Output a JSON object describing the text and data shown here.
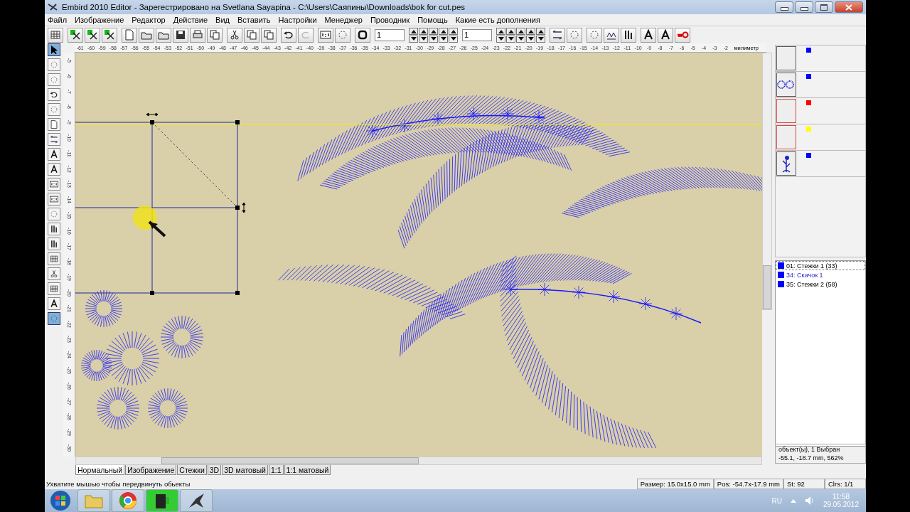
{
  "window": {
    "title": "Embird 2010 Editor - Зарегестрировано на Svetlana Sayapina - C:\\Users\\Саяпины\\Downloads\\bok for cut.pes"
  },
  "menu": [
    "Файл",
    "Изображение",
    "Редактор",
    "Действие",
    "Вид",
    "Вставить",
    "Настройки",
    "Менеджер",
    "Проводник",
    "Помощь",
    "Какие есть дополнения"
  ],
  "toolbar": {
    "fields": [
      {
        "value": "1"
      },
      {
        "value": "1"
      }
    ]
  },
  "tools": [
    {
      "selected": true
    },
    {
      "selected": false
    },
    {
      "selected": false
    },
    {
      "selected": false
    },
    {
      "selected": false
    },
    {
      "selected": false
    },
    {
      "selected": false
    },
    {
      "selected": false
    },
    {
      "selected": false
    },
    {
      "selected": false
    },
    {
      "selected": false
    },
    {
      "selected": false
    },
    {
      "selected": false
    },
    {
      "selected": false
    },
    {
      "selected": false
    },
    {
      "selected": false
    },
    {
      "selected": false
    },
    {
      "selected": false
    },
    {
      "selected": true
    }
  ],
  "ruler": {
    "unit": "милиметр",
    "marks": [
      "-61",
      "-60",
      "-59",
      "-58",
      "-57",
      "-56",
      "-55",
      "-54",
      "-53",
      "-52",
      "-51",
      "-50",
      "-49",
      "-48",
      "-47",
      "-46",
      "-45",
      "-44",
      "-43",
      "-42",
      "-41",
      "-40",
      "-39",
      "-38",
      "-37",
      "-36",
      "-35",
      "-34",
      "-33",
      "-32",
      "-31",
      "-30",
      "-29",
      "-28",
      "-27",
      "-26",
      "-25",
      "-24",
      "-23",
      "-22",
      "-21",
      "-20",
      "-19",
      "-18",
      "-17",
      "-16",
      "-15",
      "-14",
      "-13",
      "-12",
      "-11",
      "-10",
      "-9",
      "-8",
      "-7",
      "-6",
      "-5",
      "-4",
      "-3",
      "-2"
    ],
    "vertical_marks": [
      "-5",
      "-6",
      "-7",
      "-8",
      "-9",
      "-10",
      "-11",
      "-12",
      "-13",
      "-14",
      "-15",
      "-16",
      "-17",
      "-18",
      "-19",
      "-20",
      "-21",
      "-22",
      "-23",
      "-24",
      "-25",
      "-26",
      "-27",
      "-28",
      "-29",
      "-30"
    ]
  },
  "colors": [
    {
      "kind": "empty",
      "color": "#0000ff",
      "selected": false
    },
    {
      "kind": "flowers",
      "color": "#0000ff",
      "selected": false
    },
    {
      "kind": "empty",
      "color": "#ff0000",
      "selected": true
    },
    {
      "kind": "empty",
      "color": "#ffff00",
      "selected": true
    },
    {
      "kind": "sprig",
      "color": "#0000ff",
      "selected": false
    }
  ],
  "objects": [
    {
      "label": "01:  Стежки 1 (33)",
      "kind": "stitch",
      "color": "#0000ff",
      "selected": true
    },
    {
      "label": "34:  Скачок 1",
      "kind": "jump",
      "color": "#0000ff",
      "selected": false
    },
    {
      "label": "35:  Стежки 2 (58)",
      "kind": "stitch",
      "color": "#0000ff",
      "selected": false
    }
  ],
  "info": [
    "объект(ы), 1 Выбран",
    "-55.1, -18.7 mm, 562%"
  ],
  "tabs": [
    {
      "label": "Нормальный",
      "selected": true
    },
    {
      "label": "Изображение",
      "selected": false
    },
    {
      "label": "Стежки",
      "selected": false
    },
    {
      "label": "3D",
      "selected": false
    },
    {
      "label": "3D матовый",
      "selected": false
    },
    {
      "label": "1:1",
      "selected": false
    },
    {
      "label": "1:1 матовый",
      "selected": false
    }
  ],
  "status_bar": {
    "hint": "Ухватите мышью чтобы передвинуть обьекты",
    "cells": [
      "Размер: 15.0x15.0 mm",
      "Pos: -54.7x-17.9 mm",
      "St: 92",
      "Clrs: 1/1"
    ]
  },
  "taskbar": {
    "language": "RU",
    "time": "11:58",
    "date": "29.05.2012"
  }
}
